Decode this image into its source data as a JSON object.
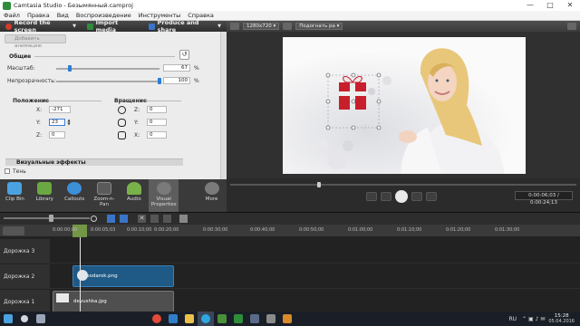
{
  "window": {
    "title": "Camtasia Studio - Безымянный.camproj",
    "minimize": "—",
    "maximize": "□",
    "close": "✕"
  },
  "menu": [
    "Файл",
    "Правка",
    "Вид",
    "Воспроизведение",
    "Инструменты",
    "Справка"
  ],
  "toolbar": [
    {
      "label": "Record the screen",
      "icon": "record-icon",
      "color": "#d33b2c"
    },
    {
      "label": "Import media",
      "icon": "import-icon",
      "color": "#2f8d3a"
    },
    {
      "label": "Produce and share",
      "icon": "share-icon",
      "color": "#3a74c9"
    }
  ],
  "properties": {
    "add_animation": "Добавить анимацию",
    "general_title": "Общие",
    "scale_label": "Масштаб:",
    "scale_value": "67",
    "scale_unit": "%",
    "scale_level": 0.67,
    "opacity_label": "Непрозрачность:",
    "opacity_value": "100",
    "opacity_unit": "%",
    "opacity_level": 1.0,
    "position_title": "Положение",
    "pos_x_label": "X:",
    "pos_x_value": "-271",
    "pos_y_label": "Y:",
    "pos_y_value": "23",
    "pos_z_label": "Z:",
    "pos_z_value": "0",
    "rotation_title": "Вращение",
    "rot_z_label": "Z:",
    "rot_z_value": "0",
    "rot_y_label": "Y:",
    "rot_y_value": "0",
    "rot_x_label": "X:",
    "rot_x_value": "0",
    "visual_effects": "Визуальные эффекты",
    "shadow_label": "Тень"
  },
  "tools": [
    {
      "label": "Clip Bin",
      "icon": "clip-bin-icon",
      "color": "#4aa3e0"
    },
    {
      "label": "Library",
      "icon": "library-icon",
      "color": "#6aa842"
    },
    {
      "label": "Callouts",
      "icon": "callouts-icon",
      "color": "#3d8fd8"
    },
    {
      "label": "Zoom-n-Pan",
      "icon": "zoom-n-pan-icon",
      "color": "#5a5a5a"
    },
    {
      "label": "Audio",
      "icon": "audio-icon",
      "color": "#7ab24a"
    },
    {
      "label": "Visual Properties",
      "icon": "visual-properties-icon",
      "color": "#7a7a7a"
    },
    {
      "label": "More",
      "icon": "more-icon",
      "color": "#7a7a7a"
    }
  ],
  "canvas": {
    "dimensions": "1280x720",
    "fit": "Подогнать ра",
    "timecode": "0:00:06;03 / 0:00:24;13"
  },
  "timeline": {
    "ticks": [
      "0:00:00;00",
      "0:00:05;03",
      "0:00:10;00",
      "0:00:20;00",
      "0:00:30;00",
      "0:00:40;00",
      "0:00:50;00",
      "0:01:00;00",
      "0:01:10;00",
      "0:01:20;00",
      "0:01:30;00"
    ],
    "tracks": [
      {
        "label": "Дорожка 3"
      },
      {
        "label": "Дорожка 2",
        "clip": "podarok.png"
      },
      {
        "label": "Дорожка 1",
        "clip": "devushka.jpg"
      }
    ]
  },
  "taskbar": {
    "lang": "RU",
    "time": "15:28",
    "date": "05.04.2016"
  }
}
